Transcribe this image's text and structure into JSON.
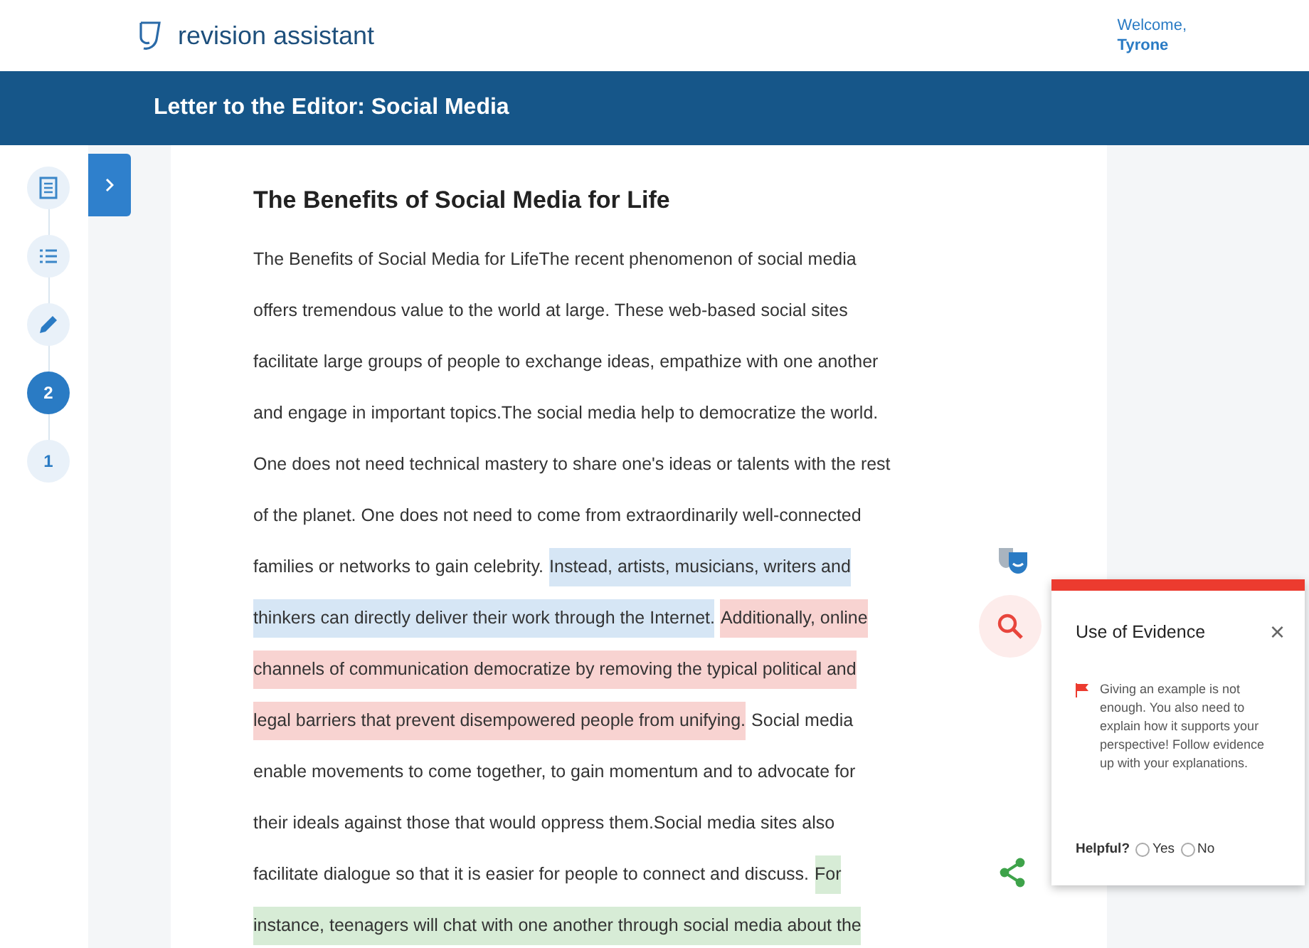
{
  "header": {
    "brand": "revision assistant",
    "welcome": "Welcome,",
    "user": "Tyrone"
  },
  "title_bar": {
    "title": "Letter to the Editor: Social Media"
  },
  "steps": [
    {
      "kind": "document",
      "selected": false
    },
    {
      "kind": "outline",
      "selected": false
    },
    {
      "kind": "pencil",
      "selected": false
    },
    {
      "kind": "number",
      "label": "2",
      "selected": true
    },
    {
      "kind": "number",
      "label": "1",
      "selected": false
    }
  ],
  "essay": {
    "title": "The Benefits of Social Media for Life",
    "lines": [
      [
        {
          "text": "The Benefits of Social Media for LifeThe recent phenomenon of social media"
        }
      ],
      [
        {
          "text": "offers tremendous value to the world at large. These web-based social sites"
        }
      ],
      [
        {
          "text": "facilitate large groups of people to exchange ideas, empathize with one another"
        }
      ],
      [
        {
          "text": "and engage in important topics.The social media help to democratize the world."
        }
      ],
      [
        {
          "text": "One does not need technical mastery to share one's ideas or talents with the rest"
        }
      ],
      [
        {
          "text": "of the planet. One does not need to come from extraordinarily well-connected"
        }
      ],
      [
        {
          "text": "families or networks to gain celebrity."
        },
        {
          "text": "Instead, artists, musicians, writers and",
          "color": "#d6e6f5"
        }
      ],
      [
        {
          "text": "thinkers can directly deliver their work through the Internet.",
          "color": "#d6e6f5"
        },
        {
          "text": "Additionally, online",
          "color": "#f8d3d1"
        }
      ],
      [
        {
          "text": "channels of communication democratize by removing the typical political and",
          "color": "#f8d3d1"
        }
      ],
      [
        {
          "text": "legal barriers that prevent disempowered people from unifying.",
          "color": "#f8d3d1"
        },
        {
          "text": "Social media"
        }
      ],
      [
        {
          "text": "enable movements to come together, to gain momentum and to advocate for"
        }
      ],
      [
        {
          "text": "their ideals against those that would oppress them.Social media sites also"
        }
      ],
      [
        {
          "text": "facilitate dialogue so that it is easier for people to connect and discuss."
        },
        {
          "text": "For",
          "color": "#d7ecd6"
        }
      ],
      [
        {
          "text": "instance, teenagers will chat with one another through social media about the",
          "color": "#d7ecd6"
        }
      ]
    ]
  },
  "feedback": {
    "title": "Use of Evidence",
    "close": "×",
    "message": "Giving an example is not enough. You also need to explain how it supports your perspective! Follow evidence up with your explanations.",
    "helpful_label": "Helpful?",
    "options": [
      {
        "label": "Yes",
        "selected": false
      },
      {
        "label": "No",
        "selected": false
      }
    ]
  }
}
